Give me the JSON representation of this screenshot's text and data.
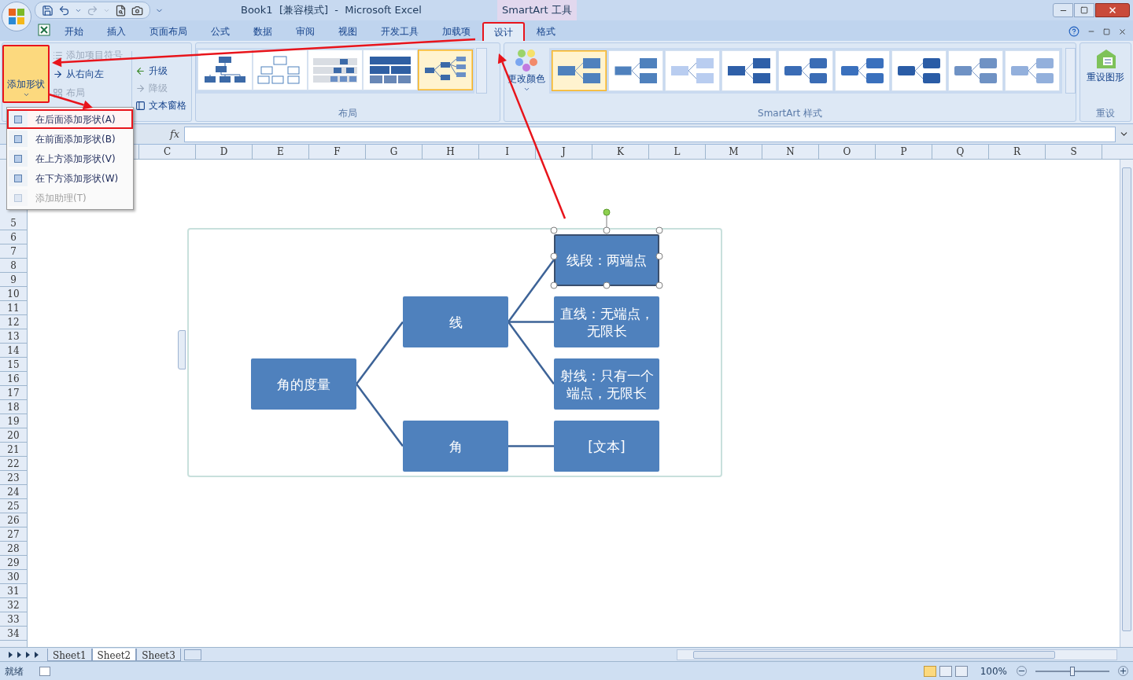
{
  "title_bar": {
    "title": "Book1  [兼容模式]  -  Microsoft Excel",
    "context_tool": "SmartArt 工具"
  },
  "tabs": [
    {
      "label": "开始",
      "selected": false,
      "highlighted": false
    },
    {
      "label": "插入",
      "selected": false,
      "highlighted": false
    },
    {
      "label": "页面布局",
      "selected": false,
      "highlighted": false
    },
    {
      "label": "公式",
      "selected": false,
      "highlighted": false
    },
    {
      "label": "数据",
      "selected": false,
      "highlighted": false
    },
    {
      "label": "审阅",
      "selected": false,
      "highlighted": false
    },
    {
      "label": "视图",
      "selected": false,
      "highlighted": false
    },
    {
      "label": "开发工具",
      "selected": false,
      "highlighted": false
    },
    {
      "label": "加载项",
      "selected": false,
      "highlighted": false
    },
    {
      "label": "设计",
      "selected": true,
      "highlighted": true
    },
    {
      "label": "格式",
      "selected": false,
      "highlighted": false
    }
  ],
  "create_group": {
    "add_shape": {
      "label": "添加形状",
      "pressed": true,
      "highlighted": true
    },
    "items": [
      {
        "label": "添加项目符号",
        "disabled": true
      },
      {
        "label": "从右向左",
        "disabled": false
      },
      {
        "label": "布局",
        "disabled": true
      }
    ],
    "level_items": [
      {
        "label": "升级",
        "disabled": false
      },
      {
        "label": "降级",
        "disabled": true
      },
      {
        "label": "文本窗格",
        "disabled": false
      }
    ]
  },
  "layouts_group": {
    "label": "布局",
    "thumbnails": [
      {
        "selected": false
      },
      {
        "selected": false
      },
      {
        "selected": false
      },
      {
        "selected": false
      },
      {
        "selected": true
      }
    ]
  },
  "styles_group": {
    "label": "SmartArt 样式",
    "change_colors": "更改颜色",
    "thumbnails": [
      {
        "selected": true,
        "color": "#4f81bd"
      },
      {
        "selected": false,
        "color": "#4f81bd"
      },
      {
        "selected": false,
        "color": "#b9cdf0"
      },
      {
        "selected": false,
        "color": "#2e5fa8"
      },
      {
        "selected": false,
        "color": "#3a6cb5"
      },
      {
        "selected": false,
        "color": "#3a70bd"
      },
      {
        "selected": false,
        "color": "#2a5ca6"
      },
      {
        "selected": false,
        "color": "#6f92c4"
      },
      {
        "selected": false,
        "color": "#93b0dc"
      }
    ]
  },
  "reset_group": {
    "label": "重设",
    "button": "重设图形"
  },
  "add_shape_menu": [
    {
      "label": "在后面添加形状(A)",
      "disabled": false,
      "highlighted": true
    },
    {
      "label": "在前面添加形状(B)",
      "disabled": false,
      "highlighted": false
    },
    {
      "label": "在上方添加形状(V)",
      "disabled": false,
      "highlighted": false
    },
    {
      "label": "在下方添加形状(W)",
      "disabled": false,
      "highlighted": false
    },
    {
      "label": "添加助理(T)",
      "disabled": true,
      "highlighted": false
    }
  ],
  "formula_bar": {
    "fx": "fx"
  },
  "columns": [
    "C",
    "D",
    "E",
    "F",
    "G",
    "H",
    "I",
    "J",
    "K",
    "L",
    "M",
    "N",
    "O",
    "P",
    "Q",
    "R",
    "S"
  ],
  "row_numbers": [
    "5",
    "6",
    "7",
    "8",
    "9",
    "10",
    "11",
    "12",
    "13",
    "14",
    "15",
    "16",
    "17",
    "18",
    "19",
    "20",
    "21",
    "22",
    "23",
    "24",
    "25",
    "26",
    "27",
    "28",
    "29",
    "30",
    "31",
    "32",
    "33",
    "34"
  ],
  "smartart": {
    "root": {
      "text": "角的度量",
      "selected": false,
      "children": [
        {
          "text": "线",
          "selected": false,
          "children": [
            {
              "text": "线段：两端点",
              "selected": true
            },
            {
              "text": "直线：无端点，无限长",
              "selected": false
            },
            {
              "text": "射线：只有一个端点，无限长",
              "selected": false
            }
          ]
        },
        {
          "text": "角",
          "selected": false,
          "children": [
            {
              "text": "[文本]",
              "selected": false
            }
          ]
        }
      ]
    }
  },
  "sheet_tabs": [
    {
      "label": "Sheet1",
      "selected": false
    },
    {
      "label": "Sheet2",
      "selected": true
    },
    {
      "label": "Sheet3",
      "selected": false
    }
  ],
  "status_bar": {
    "status": "就绪",
    "zoom": "100%",
    "zoom_level": {
      "level": 0.5
    }
  }
}
